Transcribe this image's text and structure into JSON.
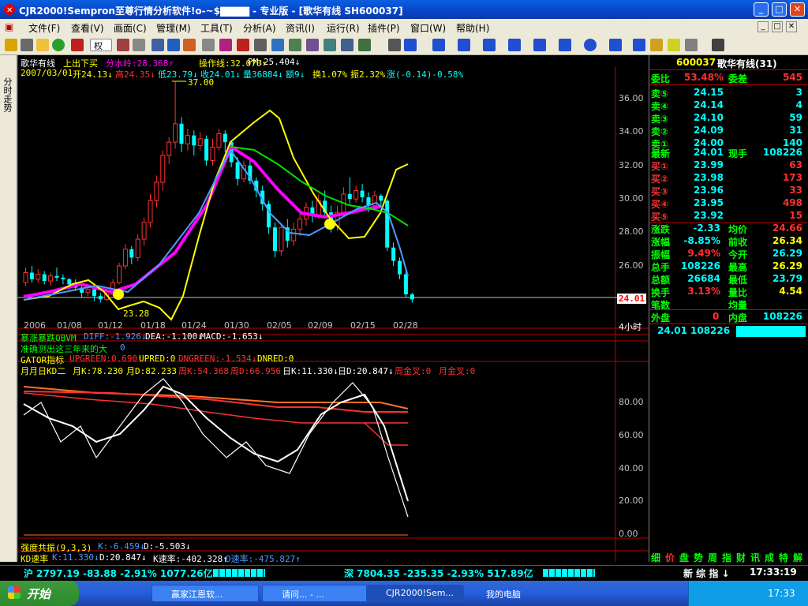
{
  "window": {
    "title": "CJR2000!Sempron至尊行情分析软件!o-~$▇▇▇▇ - 专业版 - [歌华有线  SH600037]",
    "min_label": "_",
    "max_label": "□",
    "close_label": "✕"
  },
  "menu": {
    "items": [
      "文件(F)",
      "查看(V)",
      "画面(C)",
      "管理(M)",
      "工具(T)",
      "分析(A)",
      "资讯(I)",
      "运行(R)",
      "插件(P)",
      "窗口(W)",
      "帮助(H)"
    ],
    "weight_label": "权"
  },
  "left_tab": {
    "label": "分时走势"
  },
  "chart_header": {
    "line1": {
      "name": "歌华有线",
      "ind": "上出下买",
      "f1": "分水岭:28.368↑",
      "f2": "操作线:32.070↑",
      "f3": "PM:25.404↓"
    },
    "line2": {
      "date": "2007/03/01",
      "open": "开24.13↓",
      "high": "高24.35↓",
      "low": "低23.79↓",
      "close": "收24.01↓",
      "vol": "量36884↓",
      "amt": "额9↓",
      "turn": "换1.07%",
      "amp": "振2.32%",
      "chg": "涨(-0.14)-0.58%"
    },
    "high_marker": "37.00",
    "low_marker": "23.28",
    "price_tag": "24.01"
  },
  "main_axis": {
    "y_ticks": [
      "36.00",
      "34.00",
      "32.00",
      "30.00",
      "28.00",
      "26.00"
    ],
    "x_ticks": [
      "2006",
      "01/08",
      "01/12",
      "01/18",
      "01/24",
      "01/30",
      "02/05",
      "02/09",
      "02/15",
      "02/28"
    ],
    "period": "4小时"
  },
  "sub_header": {
    "l1a": "暴涨暴跌OBVM",
    "l1b": "DIFF:-1.926↓",
    "l1c": "DEA:-1.100↓",
    "l1d": "MACD:-1.653↓",
    "l2a": "准确测出这三年来的大",
    "l2b": "0",
    "l3a": "GATOR指标",
    "l3b": "UPGREEN:0.690↑",
    "l3c": "UPRED:0",
    "l3d": "DNGREEN:-1.534↓",
    "l3e": "DNRED:0",
    "l4a": "月月日KD二",
    "l4b": "月K:78.230",
    "l4c": "月D:82.233",
    "l4d": "周K:54.368",
    "l4e": "周D:66.956",
    "l4f": "日K:11.330↓",
    "l4g": "日D:20.847↓",
    "l4h": "周金叉:0",
    "l4i": "月金叉:0"
  },
  "sub_axis": {
    "y_ticks": [
      "80.00",
      "60.00",
      "40.00",
      "20.00",
      "0.00"
    ]
  },
  "bottom_ind": {
    "l1a": "强度共振(9,3,3)",
    "l1b": "K:-6.459↓",
    "l1c": "D:-5.503↓",
    "l2a": "KD速率",
    "l2b": "K:11.330↓",
    "l2c": "D:20.847↓",
    "l2d": "K速率:-402.328↑",
    "l2e": "D速率:-475.827↑"
  },
  "quote": {
    "code": "600037",
    "name": "歌华有线(31)",
    "weibi_label": "委比",
    "weibi": "53.48%",
    "weicha_label": "委差",
    "weicha": "545",
    "sells": [
      {
        "label": "卖⑤",
        "price": "24.15",
        "vol": "3"
      },
      {
        "label": "卖④",
        "price": "24.14",
        "vol": "4"
      },
      {
        "label": "卖③",
        "price": "24.10",
        "vol": "59"
      },
      {
        "label": "卖②",
        "price": "24.09",
        "vol": "31"
      },
      {
        "label": "卖①",
        "price": "24.00",
        "vol": "140"
      }
    ],
    "last_label": "最新",
    "last": "24.01",
    "xianshou_label": "现手",
    "xianshou": "108226",
    "buys": [
      {
        "label": "买①",
        "price": "23.99",
        "vol": "63"
      },
      {
        "label": "买②",
        "price": "23.98",
        "vol": "173"
      },
      {
        "label": "买③",
        "price": "23.96",
        "vol": "33"
      },
      {
        "label": "买④",
        "price": "23.95",
        "vol": "498"
      },
      {
        "label": "买⑤",
        "price": "23.92",
        "vol": "15"
      }
    ],
    "stats": [
      {
        "l1": "涨跌",
        "v1": "-2.33",
        "l2": "均价",
        "v2": "24.66"
      },
      {
        "l1": "涨幅",
        "v1": "-8.85%",
        "l2": "前收",
        "v2": "26.34"
      },
      {
        "l1": "振幅",
        "v1": "9.49%",
        "l2": "今开",
        "v2": "26.29"
      },
      {
        "l1": "总手",
        "v1": "108226",
        "l2": "最高",
        "v2": "26.29"
      },
      {
        "l1": "总额",
        "v1": "26684",
        "l2": "最低",
        "v2": "23.79"
      },
      {
        "l1": "换手",
        "v1": "3.13%",
        "l2": "量比",
        "v2": "4.54"
      },
      {
        "l1": "笔数",
        "v1": "",
        "l2": "均量",
        "v2": ""
      }
    ],
    "waipan_label": "外盘",
    "waipan": "0",
    "neipan_label": "内盘",
    "neipan": "108226",
    "bar_price": "24.01",
    "bar_vol": "108226",
    "tabs": [
      "细",
      "价",
      "盘",
      "势",
      "周",
      "指",
      "财",
      "讯",
      "成",
      "特",
      "解"
    ]
  },
  "status": {
    "sh": "沪 2797.19 -83.88 -2.91% 1077.26亿",
    "sz": "深 7804.35 -235.35 -2.93% 517.89亿",
    "news": "新 综 指 ↓",
    "time": "17:33:19"
  },
  "taskbar": {
    "start": "开始",
    "tasks": [
      "赢家江恩软...",
      "请问... - ...",
      "CJR2000!Sem...",
      "我的电脑"
    ],
    "clock": "17:33"
  },
  "colors": {
    "up": "#ff3232",
    "down": "#00ffff",
    "ma_magenta": "#ff00ff",
    "ma_yellow": "#ffff00",
    "ma_green": "#00e000",
    "ma_blue": "#4a9cff"
  }
}
